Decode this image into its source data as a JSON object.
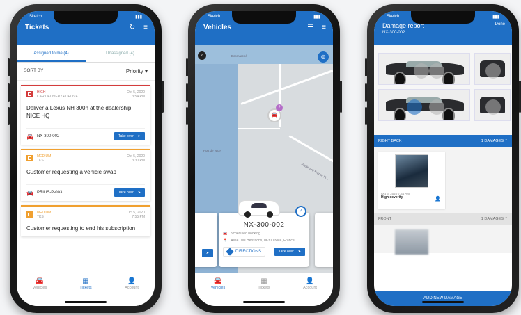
{
  "phone1": {
    "status": {
      "carrier": "Sketch",
      "time": "9:41 AM"
    },
    "title": "Tickets",
    "tabs": [
      {
        "label": "Assigned to me (4)"
      },
      {
        "label": "Unassigned (4)"
      }
    ],
    "sort_label": "SORT BY",
    "sort_value": "Priority",
    "tickets": [
      {
        "level": "HIGH",
        "category": "CAR DELIVERY • DELIVE...",
        "date": "Oct 5, 2020",
        "time": "3:54 PM",
        "description": "Deliver a Lexus NH 300h at the dealership NICE HQ",
        "plate": "NX-300-002",
        "action": "Take over"
      },
      {
        "level": "MEDIUM",
        "category": "TKS",
        "date": "Oct 5, 2020",
        "time": "3:30 PM",
        "description": "Customer requesting a vehicle swap",
        "plate": "PRIUS-P-003",
        "action": "Take over"
      },
      {
        "level": "MEDIUM",
        "category": "TKS",
        "date": "Oct 5, 2020",
        "time": "7:55 PM",
        "description": "Customer requesting to end his subscription"
      }
    ],
    "nav": [
      {
        "label": "Vehicles"
      },
      {
        "label": "Tickets"
      },
      {
        "label": "Account"
      }
    ]
  },
  "phone2": {
    "status": {
      "carrier": "Sketch",
      "time": "9:41 AM"
    },
    "title": "Vehicles",
    "map_labels": {
      "top": "Ecomarché",
      "port": "Port de Nice",
      "boulevard": "Boulevard Franck Pi..."
    },
    "pin_badge": "2",
    "card": {
      "plate": "NX-300-002",
      "status": "Scheduled booking",
      "address": "Allée Des Hérissons, 06300 Nice, France",
      "directions": "DIRECTIONS",
      "action": "Take over"
    },
    "nav": [
      {
        "label": "Vehicles"
      },
      {
        "label": "Tickets"
      },
      {
        "label": "Account"
      }
    ]
  },
  "phone3": {
    "status": {
      "carrier": "Sketch",
      "time": "9:41 AM"
    },
    "title": "Damage report",
    "subtitle": "NX-300-002",
    "done": "Done",
    "sections": [
      {
        "name": "RIGHT BACK",
        "count": "1 DAMAGES"
      },
      {
        "name": "FRONT",
        "count": "1 DAMAGES"
      }
    ],
    "damage": {
      "date": "Oct 6, 2020 7:44 AM",
      "severity": "High severity"
    },
    "add_button": "ADD NEW DAMAGE"
  },
  "colors": {
    "primary": "#1f6fc5",
    "high": "#d43c3c",
    "medium": "#f0a030"
  }
}
